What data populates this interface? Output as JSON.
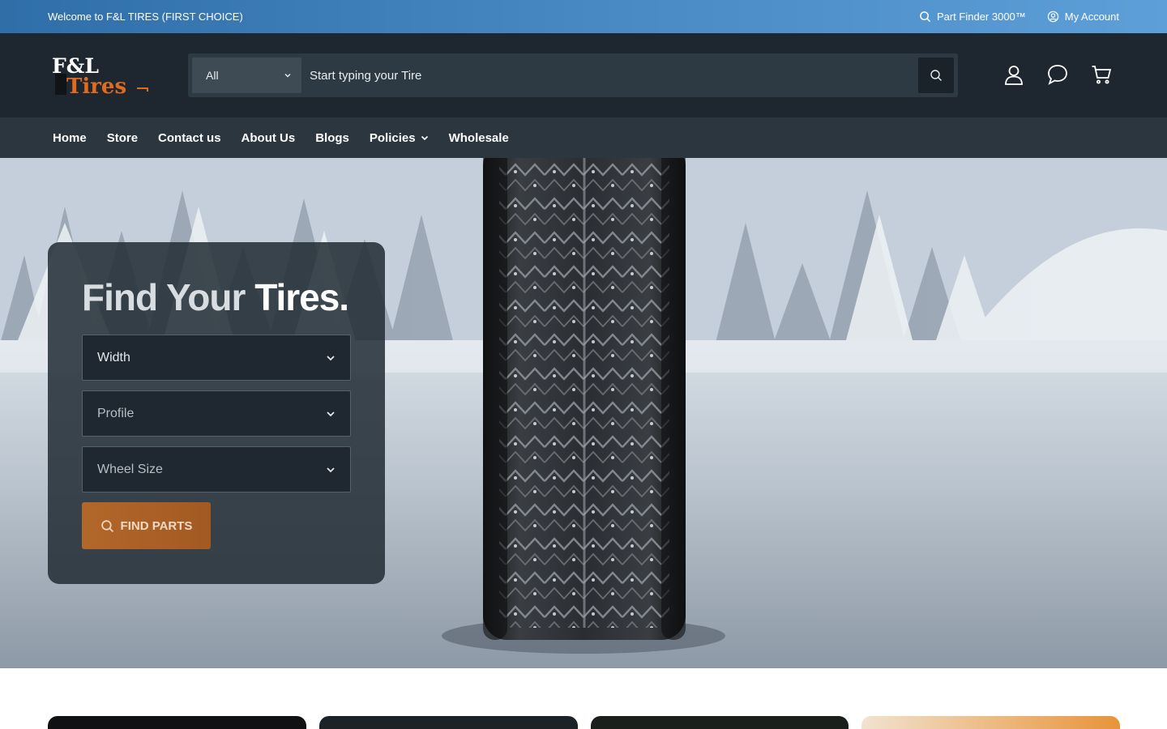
{
  "topbar": {
    "welcome": "Welcome to F&L TIRES (FIRST CHOICE)",
    "part_finder": "Part Finder 3000™",
    "account": "My Account"
  },
  "header": {
    "logo_line1": "F&L",
    "logo_line2": "Tires",
    "category": "All",
    "search_placeholder": "Start typing your Tire",
    "icons": [
      "user-icon",
      "chat-icon",
      "cart-icon"
    ]
  },
  "nav": {
    "items": [
      {
        "label": "Home"
      },
      {
        "label": "Store"
      },
      {
        "label": "Contact us"
      },
      {
        "label": "About Us"
      },
      {
        "label": "Blogs"
      },
      {
        "label": "Policies",
        "dropdown": true
      },
      {
        "label": "Wholesale"
      }
    ]
  },
  "hero": {
    "title_part1": "Find Your",
    "title_part2": "Tires.",
    "width_label": "Width",
    "profile_label": "Profile",
    "wheel_label": "Wheel Size",
    "button_label": "FIND PARTS"
  },
  "colors": {
    "topbar": "#4a8ac5",
    "header": "#1e272f",
    "nav": "#2c363e",
    "accent": "#b2672a",
    "logo_orange": "#e06a1f"
  }
}
